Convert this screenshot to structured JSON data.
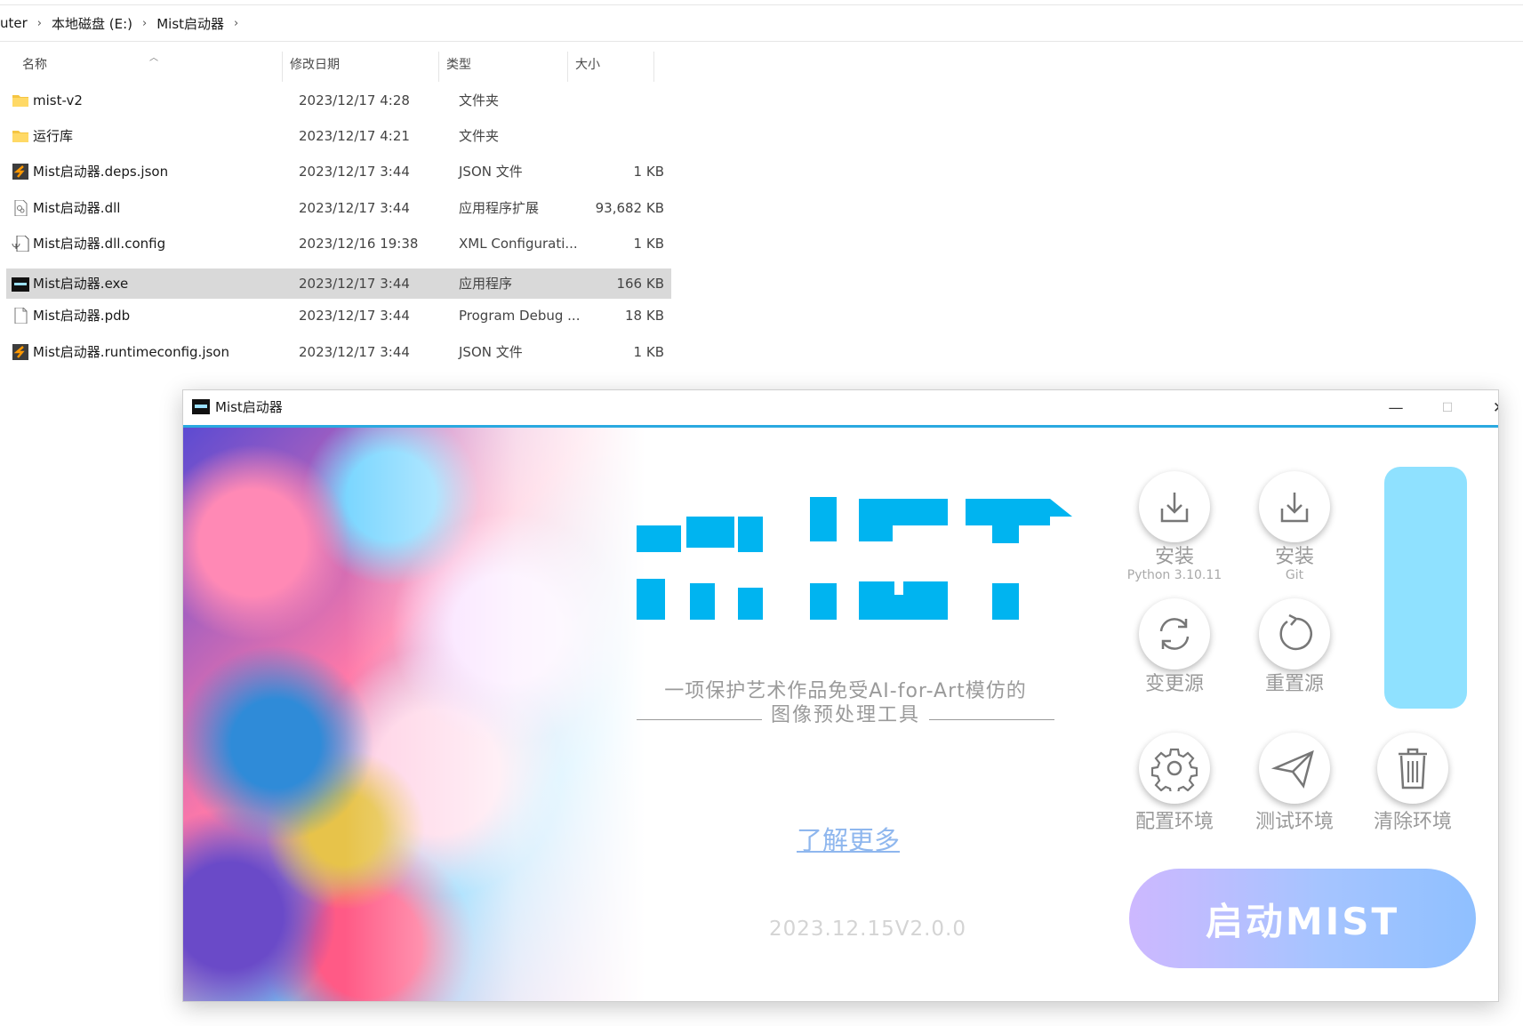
{
  "explorer": {
    "breadcrumb": [
      "uter",
      "本地磁盘 (E:)",
      "Mist启动器"
    ],
    "columns": {
      "name": "名称",
      "date": "修改日期",
      "type": "类型",
      "size": "大小"
    },
    "files": [
      {
        "name": "mist-v2",
        "date": "2023/12/17 4:28",
        "type": "文件夹",
        "size": "",
        "icon": "folder-icon"
      },
      {
        "name": "运行库",
        "date": "2023/12/17 4:21",
        "type": "文件夹",
        "size": "",
        "icon": "folder-icon"
      },
      {
        "name": "Mist启动器.deps.json",
        "date": "2023/12/17 3:44",
        "type": "JSON 文件",
        "size": "1 KB",
        "icon": "json-file-icon"
      },
      {
        "name": "Mist启动器.dll",
        "date": "2023/12/17 3:44",
        "type": "应用程序扩展",
        "size": "93,682 KB",
        "icon": "dll-file-icon"
      },
      {
        "name": "Mist启动器.dll.config",
        "date": "2023/12/16 19:38",
        "type": "XML Configurati...",
        "size": "1 KB",
        "icon": "config-file-icon"
      },
      {
        "name": "Mist启动器.exe",
        "date": "2023/12/17 3:44",
        "type": "应用程序",
        "size": "166 KB",
        "icon": "exe-file-icon",
        "selected": true
      },
      {
        "name": "Mist启动器.pdb",
        "date": "2023/12/17 3:44",
        "type": "Program Debug ...",
        "size": "18 KB",
        "icon": "blank-file-icon"
      },
      {
        "name": "Mist启动器.runtimeconfig.json",
        "date": "2023/12/17 3:44",
        "type": "JSON 文件",
        "size": "1 KB",
        "icon": "json-file-icon"
      }
    ]
  },
  "window": {
    "title": "Mist启动器",
    "controls": {
      "minimize": "—",
      "maximize": "☐",
      "close": "✕"
    }
  },
  "app": {
    "logo_text": "MIST",
    "tagline_1": "一项保护艺术作品免受AI-for-Art模仿的",
    "tagline_2": "图像预处理工具",
    "learn_more": "了解更多",
    "version": "2023.12.15V2.0.0",
    "tools": {
      "install_python": {
        "label": "安装",
        "sub": "Python 3.10.11",
        "icon": "download-icon"
      },
      "install_git": {
        "label": "安装",
        "sub": "Git",
        "icon": "download-icon"
      },
      "change_source": {
        "label": "变更源",
        "icon": "refresh-icon"
      },
      "reset_source": {
        "label": "重置源",
        "icon": "reset-icon"
      },
      "config_env": {
        "label": "配置环境",
        "icon": "gear-icon"
      },
      "test_env": {
        "label": "测试环境",
        "icon": "paper-plane-icon"
      },
      "clean_env": {
        "label": "清除环境",
        "icon": "trash-icon"
      }
    },
    "launch_button": "启动MIST",
    "colors": {
      "accent": "#00B4F0",
      "pill": "#8FE1FF",
      "launch_start": "#CDB8FF",
      "launch_end": "#8FC0FF"
    }
  }
}
